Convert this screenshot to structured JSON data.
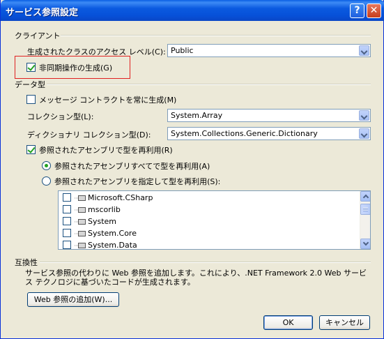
{
  "window": {
    "title": "サービス参照設定",
    "help_glyph": "?",
    "close_glyph": "✕"
  },
  "client": {
    "group_label": "クライアント",
    "access_level_label": "生成されたクラスのアクセス レベル(C):",
    "access_level_value": "Public",
    "async_label": "非同期操作の生成(G)",
    "async_checked": true
  },
  "data_type": {
    "group_label": "データ型",
    "message_contract_label": "メッセージ コントラクトを常に生成(M)",
    "message_contract_checked": false,
    "collection_label": "コレクション型(L):",
    "collection_value": "System.Array",
    "dictionary_label": "ディクショナリ コレクション型(D):",
    "dictionary_value": "System.Collections.Generic.Dictionary",
    "reuse_label": "参照されたアセンブリで型を再利用(R)",
    "reuse_checked": true,
    "reuse_all_label": "参照されたアセンブリすべてで型を再利用(A)",
    "reuse_all_selected": true,
    "reuse_specified_label": "参照されたアセンブリを指定して型を再利用(S):",
    "reuse_specified_selected": false,
    "assemblies": [
      {
        "name": "Microsoft.CSharp",
        "checked": false
      },
      {
        "name": "mscorlib",
        "checked": false
      },
      {
        "name": "System",
        "checked": false
      },
      {
        "name": "System.Core",
        "checked": false
      },
      {
        "name": "System.Data",
        "checked": false
      }
    ]
  },
  "compat": {
    "group_label": "互換性",
    "description": "サービス参照の代わりに Web 参照を追加します。これにより、.NET Framework 2.0 Web サービス テクノロジに基づいたコードが生成されます。",
    "add_web_ref_label": "Web 参照の追加(W)..."
  },
  "buttons": {
    "ok": "OK",
    "cancel": "キャンセル"
  },
  "colors": {
    "title_bar": "#0a5fe4",
    "dialog_bg": "#ece9d8",
    "highlight": "#e02020",
    "check": "#21a121"
  }
}
